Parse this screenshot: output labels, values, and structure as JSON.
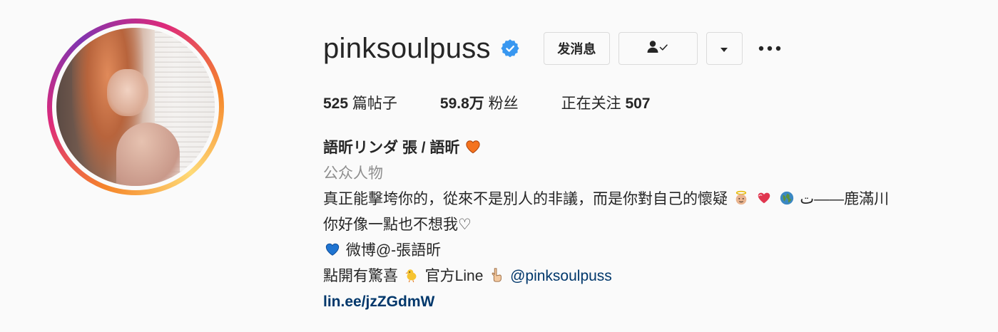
{
  "profile": {
    "username": "pinksoulpuss",
    "verified_icon": "verified-badge-icon",
    "buttons": {
      "message": "发消息",
      "following_icon": "person-check-icon",
      "dropdown_icon": "caret-down-icon",
      "more_icon": "ellipsis-icon"
    },
    "stats": {
      "posts_count": "525",
      "posts_label": "篇帖子",
      "followers_count": "59.8万",
      "followers_label": "粉丝",
      "following_label": "正在关注",
      "following_count": "507"
    },
    "bio": {
      "display_name": "語昕リンダ 張 / 語昕",
      "category": "公众人物",
      "line1": "真正能擊垮你的，從來不是別人的非議，而是你對自己的懷疑",
      "line1_tail": "ت——鹿滿川",
      "line2": "你好像一點也不想我♡",
      "line3": "微博@-張語昕",
      "line4_a": "點開有驚喜",
      "line4_b": "官方Line",
      "line4_handle": "@pinksoulpuss",
      "link": "lin.ee/jzZGdmW"
    }
  },
  "colors": {
    "verified_blue": "#3897f0",
    "link_blue": "#00376b",
    "category_gray": "#8e8e8e",
    "text": "#262626",
    "border": "#dbdbdb"
  }
}
